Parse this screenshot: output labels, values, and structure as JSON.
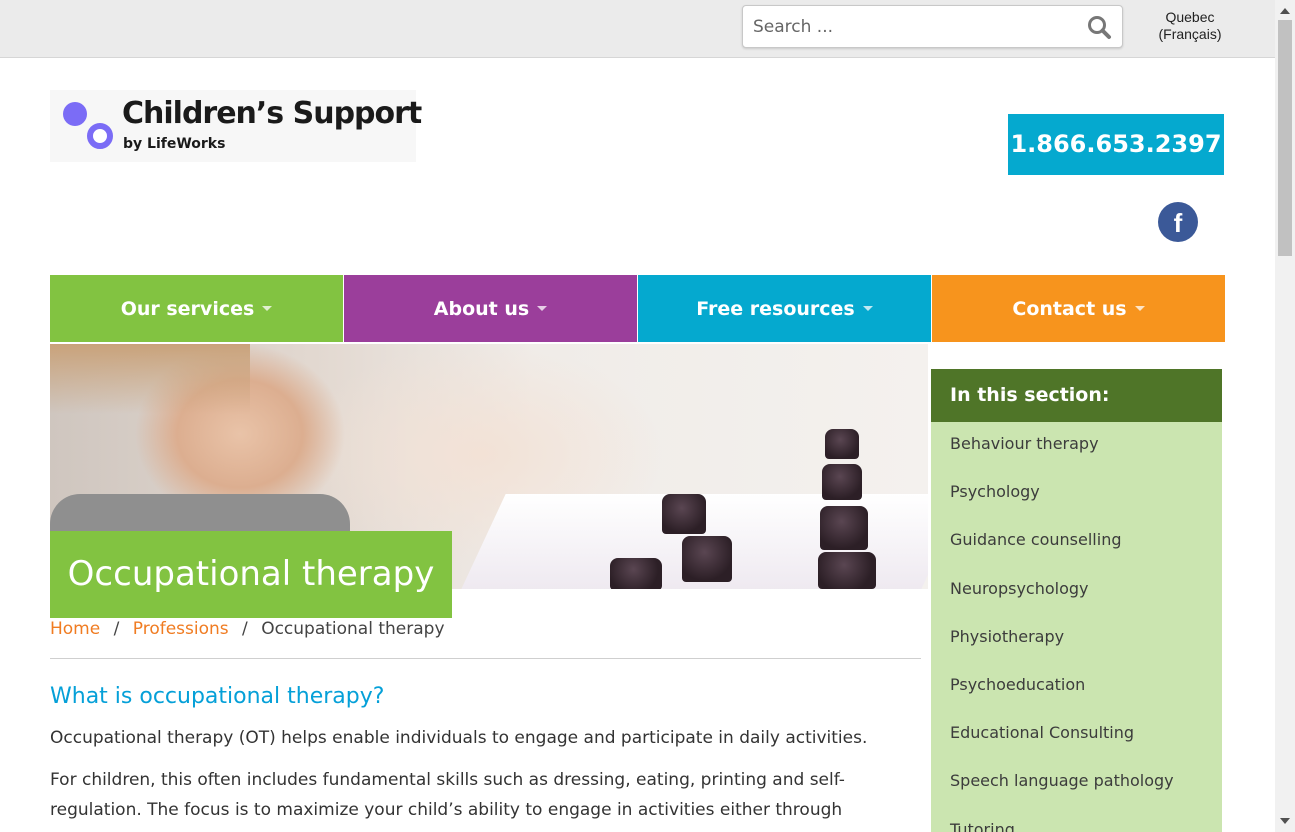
{
  "topbar": {
    "search": {
      "placeholder": "Search ...",
      "icon": "search-icon"
    },
    "language_link": {
      "line1": "Quebec",
      "line2": "(Français)"
    }
  },
  "header": {
    "logo": {
      "brand": "Children’s Support",
      "byline": "by LifeWorks"
    },
    "phone": "1.866.653.2397",
    "social": {
      "facebook_glyph": "f",
      "icon": "facebook-icon"
    }
  },
  "nav": {
    "items": [
      {
        "label": "Our services",
        "color": "#82c341"
      },
      {
        "label": "About us",
        "color": "#9b3e9b"
      },
      {
        "label": "Free resources",
        "color": "#05a9cf"
      },
      {
        "label": "Contact us",
        "color": "#f7941d"
      }
    ]
  },
  "hero": {
    "title": "Occupational therapy"
  },
  "breadcrumb": {
    "items": [
      {
        "label": "Home"
      },
      {
        "label": "Professions"
      },
      {
        "label": "Occupational therapy"
      }
    ],
    "separator": "/"
  },
  "main": {
    "heading": "What is occupational therapy?",
    "paragraphs": [
      "Occupational therapy (OT) helps enable individuals to engage and participate in daily activities.",
      "For children, this often includes fundamental skills such as dressing, eating, printing and self-regulation. The focus is to maximize your child’s ability to engage in activities either through modifying the task,"
    ]
  },
  "sidebar": {
    "title": "In this section:",
    "items": [
      {
        "label": "Behaviour therapy"
      },
      {
        "label": "Psychology"
      },
      {
        "label": "Guidance counselling"
      },
      {
        "label": "Neuropsychology"
      },
      {
        "label": "Physiotherapy"
      },
      {
        "label": "Psychoeducation"
      },
      {
        "label": "Educational Consulting"
      },
      {
        "label": "Speech language pathology"
      },
      {
        "label": "Tutoring"
      }
    ]
  },
  "colors": {
    "accent_blue": "#05a9cf",
    "heading_blue": "#05a0d8",
    "link_orange": "#f07c22",
    "green": "#82c341",
    "sidebar_dark": "#4f7528",
    "sidebar_light": "#cbe5b0"
  }
}
